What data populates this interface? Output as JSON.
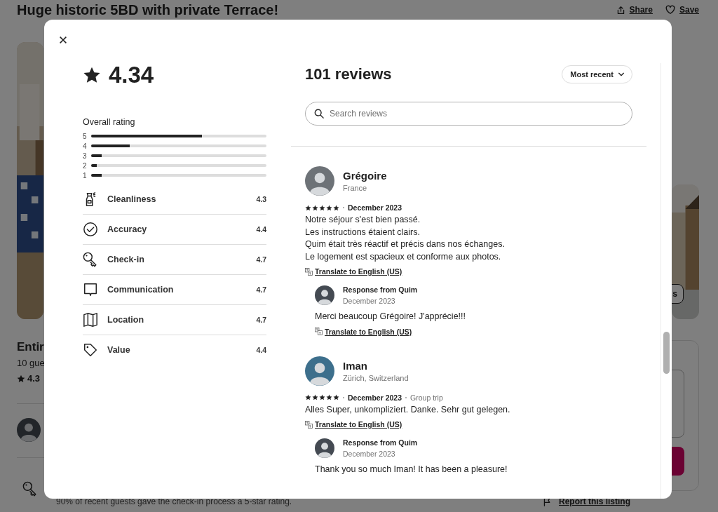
{
  "page": {
    "title": "Huge historic 5BD with private Terrace!",
    "actions": [
      {
        "kind": "share",
        "label": "Share"
      },
      {
        "kind": "save",
        "label": "Save"
      }
    ],
    "gallery_button": "s",
    "listing": {
      "heading": "Entir",
      "subheading": "10 gue",
      "rating": "4.3"
    },
    "highlight": "90% of recent guests gave the check-in process a 5-star rating.",
    "report_link": "Report this listing"
  },
  "reviews_modal": {
    "overall": {
      "score": "4.34",
      "label": "Overall rating",
      "distribution": [
        {
          "label": "5",
          "level": 0.63
        },
        {
          "label": "4",
          "level": 0.22
        },
        {
          "label": "3",
          "level": 0.06
        },
        {
          "label": "2",
          "level": 0.03
        },
        {
          "label": "1",
          "level": 0.06
        }
      ]
    },
    "categories": [
      {
        "kind": "cleanliness",
        "name": "Cleanliness",
        "score": "4.3"
      },
      {
        "kind": "accuracy",
        "name": "Accuracy",
        "score": "4.4"
      },
      {
        "kind": "checkin",
        "name": "Check-in",
        "score": "4.7"
      },
      {
        "kind": "communication",
        "name": "Communication",
        "score": "4.7"
      },
      {
        "kind": "location",
        "name": "Location",
        "score": "4.7"
      },
      {
        "kind": "value",
        "name": "Value",
        "score": "4.4"
      }
    ],
    "count": "101 reviews",
    "sort": "Most recent",
    "search": {
      "placeholder": "Search reviews"
    },
    "reviews": [
      {
        "name": "Grégoire",
        "location": "France",
        "stars": 5,
        "date": "December 2023",
        "text": "Notre séjour s'est bien passé.\nLes instructions étaient clairs.\nQuim était très réactif et précis dans nos échanges.\nLe logement est spacieux et conforme aux photos.",
        "translate": "Translate to English (US)",
        "response": {
          "title": "Response from Quim",
          "date": "December 2023",
          "text": "Merci beaucoup Grégoire! J'apprécie!!!",
          "translate": "Translate to English (US)"
        }
      },
      {
        "name": "Iman",
        "location": "Zürich, Switzerland",
        "stars": 5,
        "date": "December 2023",
        "trip_type": "Group trip",
        "text": "Alles Super, unkompliziert. Danke. Sehr gut gelegen.",
        "translate": "Translate to English (US)",
        "response": {
          "title": "Response from Quim",
          "date": "December 2023",
          "text": "Thank you so much Iman! It has been a pleasure!"
        }
      }
    ]
  }
}
